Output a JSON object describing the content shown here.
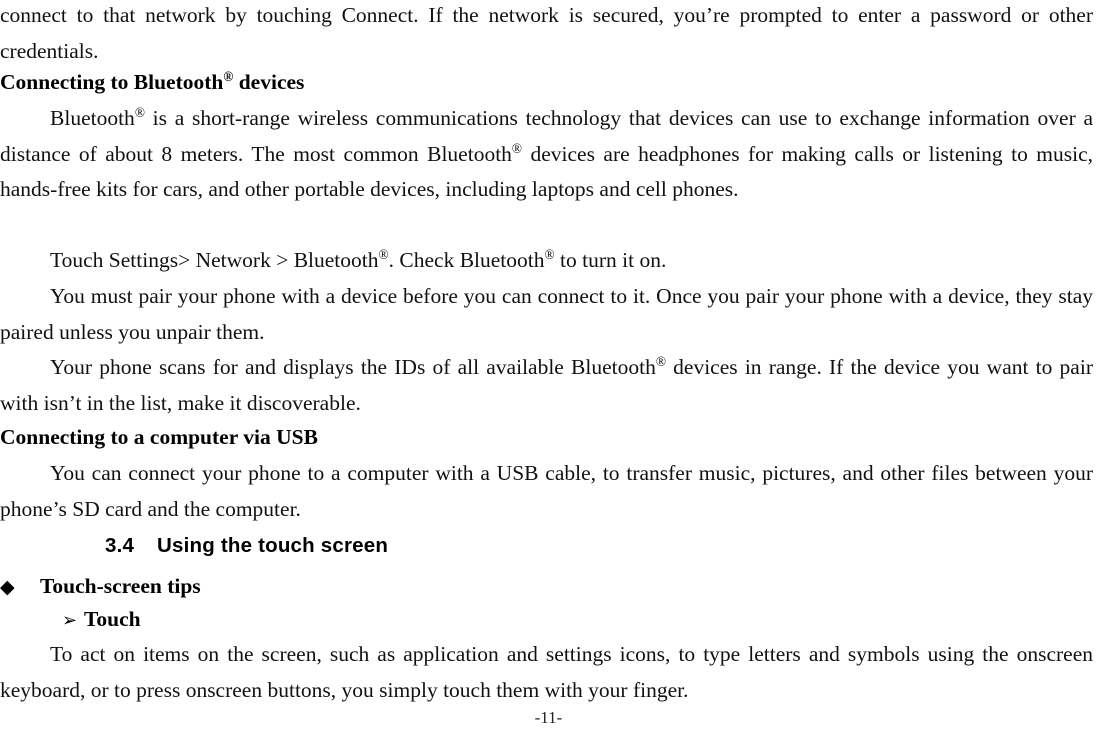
{
  "document": {
    "page_number_label": "-11-",
    "registered_mark": "®",
    "bullets": {
      "diamond": "◆",
      "arrow": "➢"
    },
    "paragraphs": {
      "wifi_continuation_a": "connect to that network by touching Connect. If the network is secured, you’re prompted to enter a password",
      "wifi_continuation_b": "or other credentials.",
      "bluetooth_intro_pre": "Bluetooth",
      "bluetooth_intro_post": " is a short-range wireless communications technology that devices can use to exchange information over a distance of about 8 meters. The most common Bluetooth",
      "bluetooth_intro_tail": " devices are headphones for making calls or listening to music, hands-free kits for cars, and other portable devices, including laptops and cell phones.",
      "bluetooth_path_pre": "Touch Settings> Network > Bluetooth",
      "bluetooth_path_mid": ". Check Bluetooth",
      "bluetooth_path_post": " to turn it on.",
      "pairing": "You must pair your phone with a device before you can connect to it. Once you pair your phone with a device, they stay paired unless you unpair them.",
      "scanning_pre": "Your phone scans for and displays the IDs of all available Bluetooth",
      "scanning_post": " devices in range. If the device you want to pair with isn’t in the list, make it discoverable.",
      "usb_body": "You can connect your phone to a computer with a USB cable, to transfer music, pictures, and other files between your phone’s SD card and the computer.",
      "touch_body": "To act on items on the screen, such as application and settings icons, to type letters and symbols using the onscreen keyboard, or to press onscreen buttons, you simply touch them with your finger."
    },
    "headings": {
      "bluetooth_devices_pre": "Connecting to Bluetooth",
      "bluetooth_devices_post": " devices",
      "usb_heading": "Connecting to a computer via USB",
      "section_number": "3.4",
      "section_title": "Using the touch screen",
      "touch_screen_tips": "Touch-screen tips",
      "touch_sub": "Touch"
    }
  }
}
